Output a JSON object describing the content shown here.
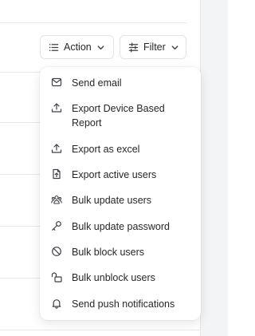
{
  "toolbar": {
    "action_label": "Action",
    "filter_label": "Filter"
  },
  "menu": {
    "items": [
      {
        "label": "Send email",
        "icon": "mail-icon"
      },
      {
        "label": "Export Device Based Report",
        "icon": "upload-icon"
      },
      {
        "label": "Export as excel",
        "icon": "upload-icon"
      },
      {
        "label": "Export active users",
        "icon": "file-export-icon"
      },
      {
        "label": "Bulk update users",
        "icon": "users-icon"
      },
      {
        "label": "Bulk update password",
        "icon": "key-icon"
      },
      {
        "label": "Bulk block users",
        "icon": "ban-icon"
      },
      {
        "label": "Bulk unblock users",
        "icon": "unlock-icon"
      },
      {
        "label": "Send push notifications",
        "icon": "bell-icon"
      }
    ]
  }
}
